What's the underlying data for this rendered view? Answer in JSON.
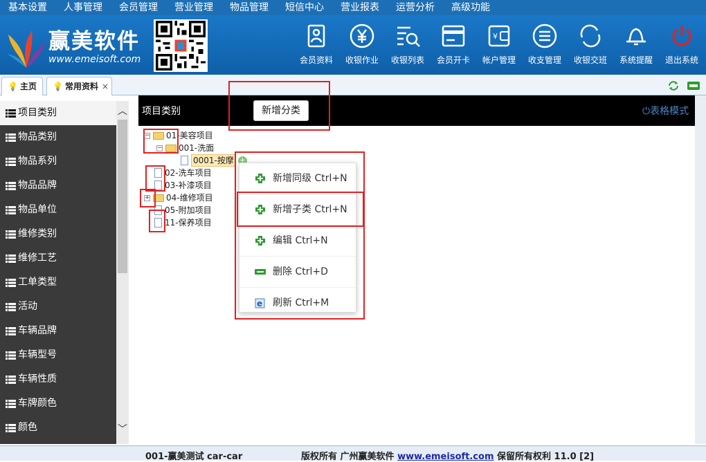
{
  "top_menu": [
    "基本设置",
    "人事管理",
    "会员管理",
    "营业管理",
    "物品管理",
    "短信中心",
    "营业报表",
    "运营分析",
    "高级功能"
  ],
  "brand": {
    "name": "赢美软件",
    "url": "www.emeisoft.com"
  },
  "toolbar": [
    {
      "label": "会员资料",
      "icon": "member-card-icon"
    },
    {
      "label": "收银作业",
      "icon": "yen-icon"
    },
    {
      "label": "收银列表",
      "icon": "list-search-icon"
    },
    {
      "label": "会员开卡",
      "icon": "card-icon"
    },
    {
      "label": "帐户管理",
      "icon": "wallet-icon"
    },
    {
      "label": "收支管理",
      "icon": "lines-icon"
    },
    {
      "label": "收银交班",
      "icon": "cycle-icon"
    },
    {
      "label": "系统提醒",
      "icon": "bell-icon"
    },
    {
      "label": "退出系统",
      "icon": "power-icon"
    }
  ],
  "tabs": [
    {
      "label": "主页"
    },
    {
      "label": "常用资料",
      "close": "×"
    }
  ],
  "sidebar": {
    "items": [
      "项目类别",
      "物品类别",
      "物品系列",
      "物品品牌",
      "物品单位",
      "维修类别",
      "维修工艺",
      "工单类型",
      "活动",
      "车辆品牌",
      "车辆型号",
      "车辆性质",
      "车牌颜色",
      "颜色"
    ],
    "active": 0
  },
  "content": {
    "title": "项目类别",
    "add_category": "新增分类",
    "table_mode": "表格模式"
  },
  "tree": [
    {
      "label": "01-美容项目",
      "type": "folder",
      "toggle": "−"
    },
    {
      "label": "001-洗面",
      "type": "folder",
      "toggle": "−"
    },
    {
      "label": "0001-按摩",
      "type": "doc",
      "selected": true
    },
    {
      "label": "02-洗车项目",
      "type": "doc"
    },
    {
      "label": "03-补漆项目",
      "type": "doc"
    },
    {
      "label": "04-维修项目",
      "type": "folder",
      "toggle": "+"
    },
    {
      "label": "05-附加项目",
      "type": "doc"
    },
    {
      "label": "11-保养项目",
      "type": "doc"
    }
  ],
  "context_menu": [
    {
      "label": "新增同级 Ctrl+N",
      "icon": "green-plus-icon"
    },
    {
      "label": "新增子类 Ctrl+N",
      "icon": "green-plus-icon"
    },
    {
      "label": "编辑 Ctrl+N",
      "icon": "green-plus-icon"
    },
    {
      "label": "删除 Ctrl+D",
      "icon": "minus-icon"
    },
    {
      "label": "刷新 Ctrl+M",
      "icon": "ie-refresh-icon"
    }
  ],
  "footer": {
    "user": "001-赢美测试 car-car",
    "copyright_prefix": "版权所有 广州赢美软件 ",
    "site": "www.emeisoft.com",
    "copyright_suffix": " 保留所有权利 11.0 [2]"
  },
  "colors": {
    "header_blue": "#1a78c8",
    "sidebar": "#3a3a3a",
    "annotation_red": "#e02020",
    "link_blue": "#4a86c6"
  }
}
